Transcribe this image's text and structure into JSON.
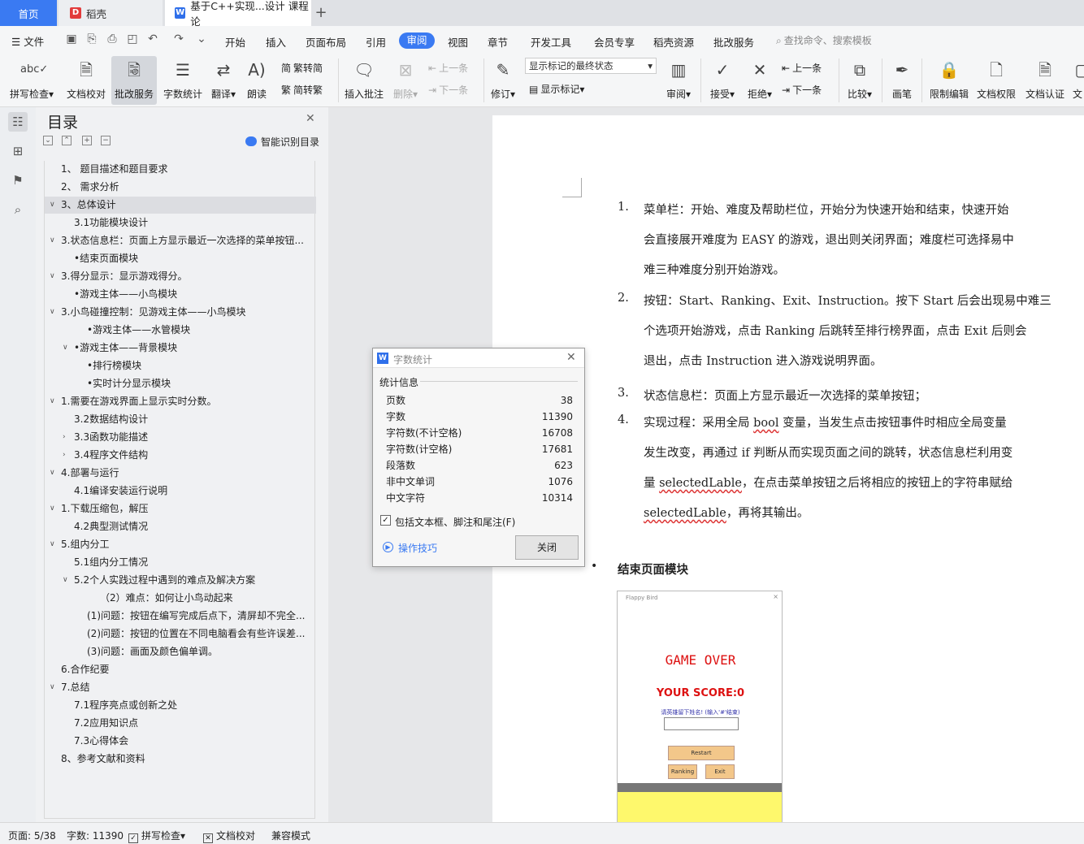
{
  "tabs": {
    "home": "首页",
    "daoke": "稻壳",
    "doc": "基于C++实现...设计 课程论",
    "plus": "+"
  },
  "menubar": {
    "file": "文件",
    "items": [
      "开始",
      "插入",
      "页面布局",
      "引用",
      "审阅",
      "视图",
      "章节",
      "开发工具",
      "会员专享",
      "稻壳资源",
      "批改服务"
    ],
    "active": "审阅",
    "search": "查找命令、搜索模板"
  },
  "ribbon": {
    "spellcheck": "拼写检查",
    "doccheck": "文档校对",
    "correct": "批改服务",
    "wordcount": "字数统计",
    "translate": "翻译",
    "read": "朗读",
    "trad": "繁转简",
    "simp": "简转繁",
    "insert_comment": "插入批注",
    "delete": "删除",
    "prev": "上一条",
    "next": "下一条",
    "revise": "修订",
    "mark_state": "显示标记的最终状态",
    "show_mark": "显示标记",
    "review": "审阅",
    "accept": "接受",
    "reject": "拒绝",
    "prev2": "上一条",
    "next2": "下一条",
    "compare": "比较",
    "pen": "画笔",
    "restrict": "限制编辑",
    "perm": "文档权限",
    "cert": "文档认证",
    "more": "文"
  },
  "nav": {
    "title": "目录",
    "smart": "智能识别目录",
    "items": [
      "1、 题目描述和题目要求",
      "2、 需求分析",
      "3、总体设计",
      "3.1功能模块设计",
      "3.状态信息栏：页面上方显示最近一次选择的菜单按钮...",
      "•结束页面模块",
      "3.得分显示：显示游戏得分。",
      "•游戏主体——小鸟模块",
      "3.小鸟碰撞控制：见游戏主体——小鸟模块",
      "•游戏主体——水管模块",
      "•游戏主体——背景模块",
      "•排行榜模块",
      "•实时计分显示模块",
      "1.需要在游戏界面上显示实时分数。",
      "3.2数据结构设计",
      "3.3函数功能描述",
      "3.4程序文件结构",
      "4.部署与运行",
      "4.1编译安装运行说明",
      "1.下载压缩包，解压",
      "4.2典型测试情况",
      "5.组内分工",
      "5.1组内分工情况",
      "5.2个人实践过程中遇到的难点及解决方案",
      "（2）难点：如何让小鸟动起来",
      "(1)问题：按钮在编写完成后点下，清屏却不完全...",
      "(2)问题：按钮的位置在不同电脑看会有些许误差...",
      "(3)问题：画面及颜色偏单调。",
      "6.合作纪要",
      "7.总结",
      "7.1程序亮点或创新之处",
      "7.2应用知识点",
      "7.3心得体会",
      "8、参考文献和资料"
    ]
  },
  "doc": {
    "list": [
      {
        "num": "1.",
        "lines": [
          "菜单栏：开始、难度及帮助栏位，开始分为快速开始和结束，快速开始",
          "会直接展开难度为 EASY 的游戏，退出则关闭界面；难度栏可选择易中",
          "难三种难度分别开始游戏。"
        ]
      },
      {
        "num": "2.",
        "lines": [
          "按钮：Start、Ranking、Exit、Instruction。按下 Start 后会出现易中难三",
          "个选项开始游戏，点击 Ranking 后跳转至排行榜界面，点击 Exit 后则会",
          "退出，点击 Instruction 进入游戏说明界面。"
        ]
      },
      {
        "num": "3.",
        "lines": [
          "状态信息栏：页面上方显示最近一次选择的菜单按钮；"
        ]
      },
      {
        "num": "4.",
        "lines": [
          "实现过程：采用全局 bool 变量，当发生点击按钮事件时相应全局变量",
          "发生改变，再通过 if 判断从而实现页面之间的跳转，状态信息栏利用变",
          "量 selectedLable，在点击菜单按钮之后将相应的按钮上的字符串赋给",
          "selectedLable，再将其输出。"
        ]
      }
    ],
    "bullet": "•",
    "heading": "结束页面模块"
  },
  "game": {
    "title": "Flappy Bird",
    "close": "×",
    "over": "GAME OVER",
    "score": "YOUR SCORE:0",
    "prompt": "请英雄留下姓名! (输入'#'结束)",
    "restart": "Restart",
    "ranking": "Ranking",
    "exit": "Exit"
  },
  "dialog": {
    "title": "字数统计",
    "section": "统计信息",
    "rows": [
      {
        "label": "页数",
        "value": "38"
      },
      {
        "label": "字数",
        "value": "11390"
      },
      {
        "label": "字符数(不计空格)",
        "value": "16708"
      },
      {
        "label": "字符数(计空格)",
        "value": "17681"
      },
      {
        "label": "段落数",
        "value": "623"
      },
      {
        "label": "非中文单词",
        "value": "1076"
      },
      {
        "label": "中文字符",
        "value": "10314"
      }
    ],
    "checkbox": "包括文本框、脚注和尾注(F)",
    "checked": true,
    "tips": "操作技巧",
    "close": "关闭"
  },
  "status": {
    "page": "页面: 5/38",
    "words": "字数: 11390",
    "spell": "拼写检查",
    "proof": "文档校对",
    "compat": "兼容模式"
  },
  "colors": {
    "accent": "#3a7af2",
    "game_red": "#dd1111",
    "sand": "#fef86c"
  }
}
